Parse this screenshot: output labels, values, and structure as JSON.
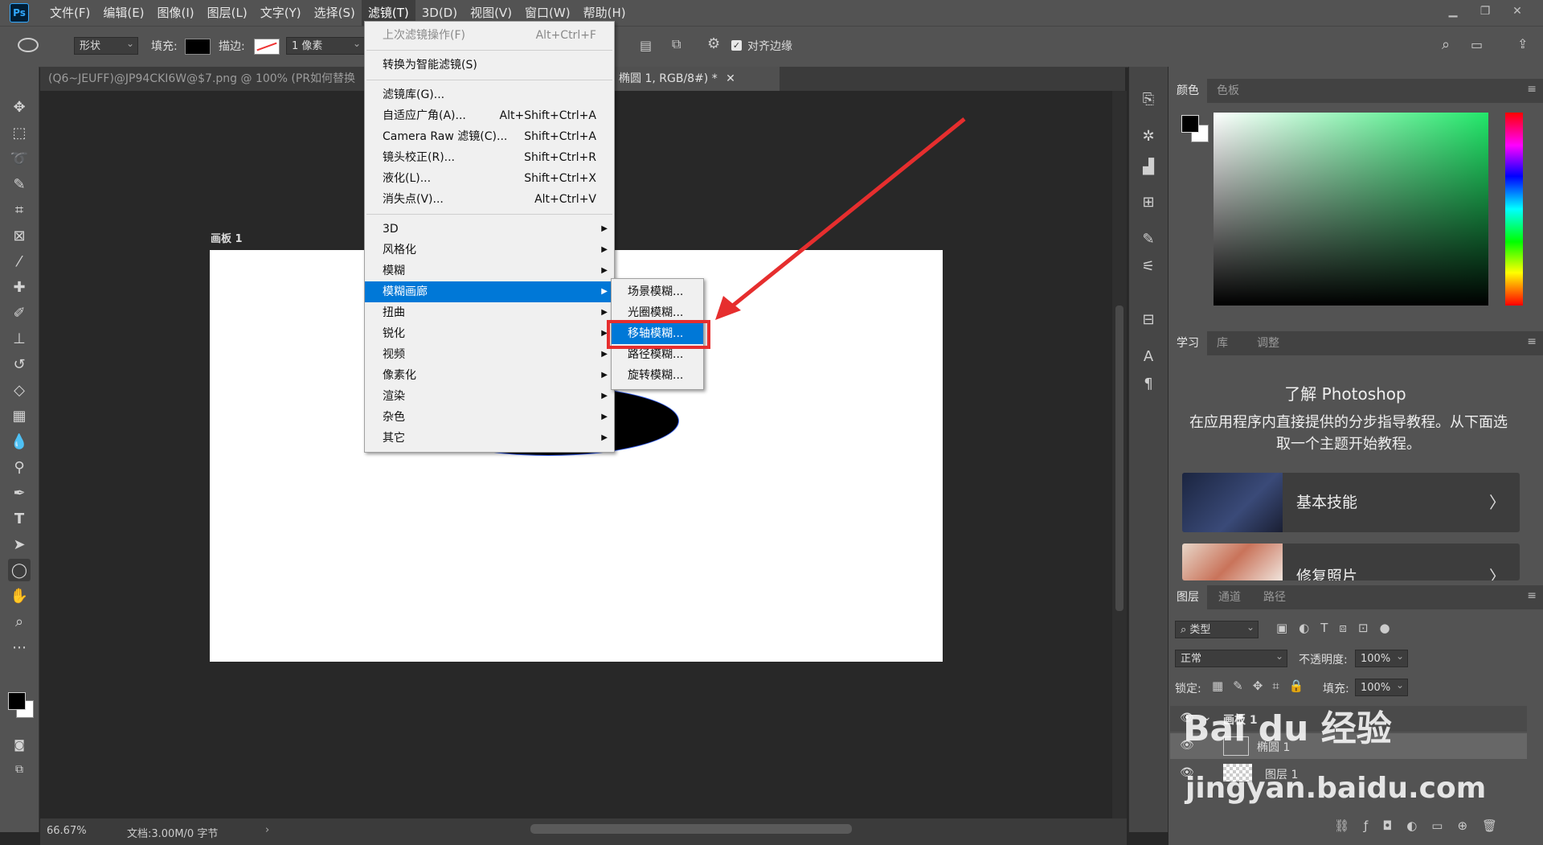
{
  "menubar": {
    "logo": "Ps",
    "items": [
      "文件(F)",
      "编辑(E)",
      "图像(I)",
      "图层(L)",
      "文字(Y)",
      "选择(S)",
      "滤镜(T)",
      "3D(D)",
      "视图(V)",
      "窗口(W)",
      "帮助(H)"
    ],
    "active_index": 6
  },
  "options_bar": {
    "mode": "形状",
    "fill_label": "填充:",
    "stroke_label": "描边:",
    "stroke_width": "1 像素",
    "align_edges_label": "对齐边缘",
    "align_edges_checked": true
  },
  "tabs": [
    {
      "label": "(Q6~JEUFF)@JP94CKI6W@$7.png @ 100% (PR如何替换"
    },
    {
      "label": "椭圆 1, RGB/8#) *"
    }
  ],
  "artboard": {
    "label": "画板 1"
  },
  "filter_menu": {
    "items": [
      {
        "label": "上次滤镜操作(F)",
        "shortcut": "Alt+Ctrl+F",
        "disabled": true
      },
      {
        "label": "转换为智能滤镜(S)",
        "shortcut": ""
      },
      {
        "label": "滤镜库(G)...",
        "shortcut": ""
      },
      {
        "label": "自适应广角(A)...",
        "shortcut": "Alt+Shift+Ctrl+A"
      },
      {
        "label": "Camera Raw 滤镜(C)...",
        "shortcut": "Shift+Ctrl+A"
      },
      {
        "label": "镜头校正(R)...",
        "shortcut": "Shift+Ctrl+R"
      },
      {
        "label": "液化(L)...",
        "shortcut": "Shift+Ctrl+X"
      },
      {
        "label": "消失点(V)...",
        "shortcut": "Alt+Ctrl+V"
      },
      {
        "label": "3D",
        "submenu": true
      },
      {
        "label": "风格化",
        "submenu": true
      },
      {
        "label": "模糊",
        "submenu": true
      },
      {
        "label": "模糊画廊",
        "submenu": true,
        "highlighted": true
      },
      {
        "label": "扭曲",
        "submenu": true
      },
      {
        "label": "锐化",
        "submenu": true
      },
      {
        "label": "视频",
        "submenu": true
      },
      {
        "label": "像素化",
        "submenu": true
      },
      {
        "label": "渲染",
        "submenu": true
      },
      {
        "label": "杂色",
        "submenu": true
      },
      {
        "label": "其它",
        "submenu": true
      }
    ]
  },
  "blur_gallery_submenu": {
    "items": [
      {
        "label": "场景模糊..."
      },
      {
        "label": "光圈模糊..."
      },
      {
        "label": "移轴模糊...",
        "highlighted": true
      },
      {
        "label": "路径模糊..."
      },
      {
        "label": "旋转模糊..."
      }
    ]
  },
  "status_bar": {
    "zoom": "66.67%",
    "doc": "文档:3.00M/0 字节"
  },
  "color_panel": {
    "tabs": [
      "颜色",
      "色板"
    ],
    "foreground": "#000000",
    "background": "#ffffff"
  },
  "learn_panel": {
    "tabs": [
      "学习",
      "库",
      "调整"
    ],
    "title": "了解 Photoshop",
    "description": "在应用程序内直接提供的分步指导教程。从下面选取一个主题开始教程。",
    "cards": [
      {
        "label": "基本技能"
      },
      {
        "label": "修复照片"
      }
    ]
  },
  "layers_panel": {
    "tabs": [
      "图层",
      "通道",
      "路径"
    ],
    "filter_kind": "类型",
    "blend_mode": "正常",
    "opacity_label": "不透明度:",
    "opacity": "100%",
    "lock_label": "锁定:",
    "fill_label": "填充:",
    "fill": "100%",
    "layers": [
      {
        "name": "画板 1"
      },
      {
        "name": "椭圆 1"
      },
      {
        "name": "图层 1"
      }
    ]
  },
  "watermark": {
    "brand": "Bai du 经验",
    "url": "jingyan.baidu.com"
  },
  "colors": {
    "menu_highlight": "#0078d7",
    "annotation_red": "#e62e2e"
  }
}
